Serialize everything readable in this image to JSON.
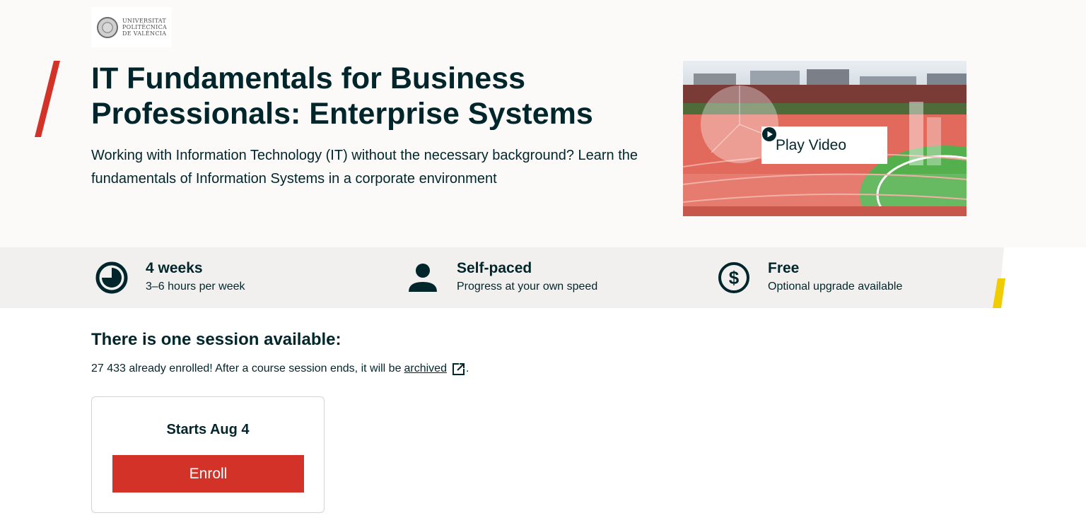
{
  "university": {
    "logo_line1": "UNIVERSITAT",
    "logo_line2": "POLITÈCNICA",
    "logo_line3": "DE VALÈNCIA"
  },
  "course": {
    "title": "IT Fundamentals for Business Professionals: Enterprise Systems",
    "subtitle": "Working with Information Technology (IT) without the necessary background? Learn the fundamentals of Information Systems in a corporate environment"
  },
  "video": {
    "play_label": "Play Video"
  },
  "stats": [
    {
      "title": "4 weeks",
      "subtitle": "3–6 hours per week",
      "icon": "clock-icon"
    },
    {
      "title": "Self-paced",
      "subtitle": "Progress at your own speed",
      "icon": "person-icon"
    },
    {
      "title": "Free",
      "subtitle": "Optional upgrade available",
      "icon": "dollar-icon"
    }
  ],
  "sessions": {
    "heading": "There is one session available:",
    "enrolled_text": "27 433 already enrolled! After a course session ends, it will be",
    "archived_link": "archived",
    "trailing_period": ".",
    "cards": [
      {
        "start": "Starts Aug 4",
        "button": "Enroll"
      }
    ]
  },
  "colors": {
    "brand_red": "#d23228",
    "accent_yellow": "#f0cc00",
    "text_dark": "#00262b",
    "stats_band": "#f2f0ef",
    "hero_bg": "#fbfaf9"
  }
}
